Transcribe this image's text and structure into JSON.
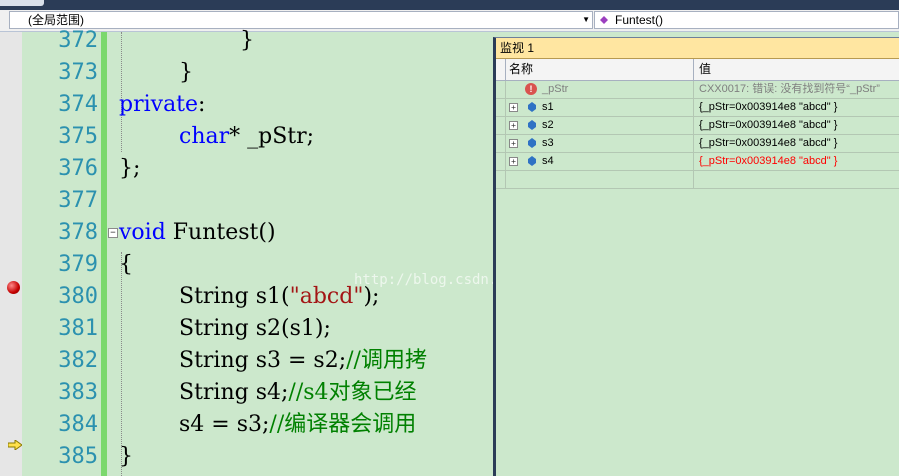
{
  "nav": {
    "scope_label": "(全局范围)",
    "function_label": "Funtest()"
  },
  "editor": {
    "lines": [
      {
        "num": "372",
        "text": "    }"
      },
      {
        "num": "373",
        "text": "  }"
      },
      {
        "num": "374",
        "text": "private:"
      },
      {
        "num": "375",
        "text": "  char* _pStr;"
      },
      {
        "num": "376",
        "text": "};"
      },
      {
        "num": "377",
        "text": ""
      },
      {
        "num": "378",
        "text": "void Funtest()"
      },
      {
        "num": "379",
        "text": "{"
      },
      {
        "num": "380",
        "text": "  String s1(\"abcd\");"
      },
      {
        "num": "381",
        "text": "  String s2(s1);"
      },
      {
        "num": "382",
        "text": "  String s3 = s2;//调用拷"
      },
      {
        "num": "383",
        "text": "  String s4;//s4对象已经"
      },
      {
        "num": "384",
        "text": "  s4 = s3;//编译器会调用"
      },
      {
        "num": "385",
        "text": "}"
      }
    ],
    "tokens": {
      "private_kw": "private",
      "colon": ":",
      "char_kw": "char",
      "pstr_decl": "* _pStr;",
      "close_class": "};",
      "void_kw": "void",
      "funtest_sig": " Funtest()",
      "open_brace": "{",
      "s1_prefix": "String s1(",
      "s1_str": "\"abcd\"",
      "s1_suffix": ");",
      "s2_line": "String s2(s1);",
      "s3_code": "String s3 = s2;",
      "s3_comment": "//调用拷",
      "s4_code": "String s4;",
      "s4_comment": "//s4对象已经",
      "assign_code": "s4 = s3;",
      "assign_comment": "//编译器会调用",
      "close_brace": "}",
      "brace_372": "}",
      "brace_373": "}"
    },
    "watermark": "http://blog.csdn.net/"
  },
  "watch": {
    "title": "监视 1",
    "col_name": "名称",
    "col_value": "值",
    "rows": [
      {
        "name": "_pStr",
        "value": "CXX0017: 错误: 没有找到符号“_pStr”",
        "state": "error"
      },
      {
        "name": "s1",
        "value": "{_pStr=0x003914e8 \"abcd\" }",
        "state": "normal"
      },
      {
        "name": "s2",
        "value": "{_pStr=0x003914e8 \"abcd\" }",
        "state": "normal"
      },
      {
        "name": "s3",
        "value": "{_pStr=0x003914e8 \"abcd\" }",
        "state": "normal"
      },
      {
        "name": "s4",
        "value": "{_pStr=0x003914e8 \"abcd\" }",
        "state": "changed"
      }
    ]
  },
  "colors": {
    "editor_bg": "#cce8cc",
    "keyword": "#0000ff",
    "string": "#a31515",
    "comment": "#008000",
    "line_number": "#2b91af",
    "changed_value": "#ff0000"
  }
}
